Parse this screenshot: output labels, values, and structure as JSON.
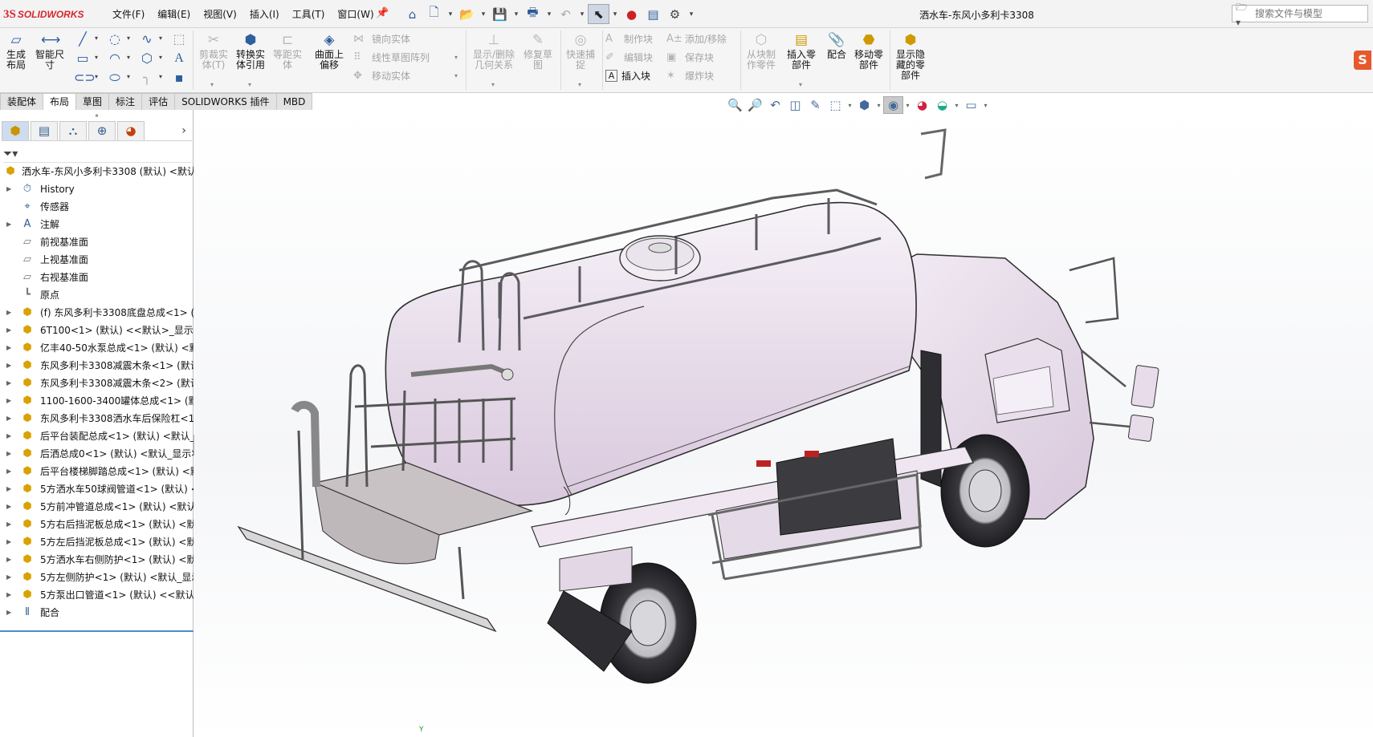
{
  "app": {
    "logo_ds": "3S",
    "logo_text": "SOLIDWORKS",
    "doc_title": "洒水车-东风小多利卡3308"
  },
  "menus": [
    "文件(F)",
    "编辑(E)",
    "视图(V)",
    "插入(I)",
    "工具(T)",
    "窗口(W)"
  ],
  "search": {
    "placeholder": "搜索文件与模型"
  },
  "ribbon": {
    "generate_layout": "生成\n布局",
    "smart_dimension": "智能尺\n寸",
    "trim_entities": "剪裁实\n体(T)",
    "convert_entities": "转换实\n体引用",
    "offset_entities": "等距实\n体",
    "offset_on_surface": "曲面上\n偏移",
    "mirror_entities": "镜向实体",
    "linear_pattern": "线性草图阵列",
    "move_entities": "移动实体",
    "display_relations": "显示/删除\n几何关系",
    "repair_sketch": "修复草\n图",
    "quick_snap": "快速捕\n捉",
    "make_block": "制作块",
    "edit_block": "编辑块",
    "insert_block": "插入块",
    "add_remove": "添加/移除",
    "save_block": "保存块",
    "explode_block": "爆炸块",
    "make_part_from_block": "从块制\n作零件",
    "insert_component": "插入零\n部件",
    "mate": "配合",
    "move_component": "移动零\n部件",
    "show_hidden": "显示隐\n藏的零\n部件"
  },
  "tabs": [
    "装配体",
    "布局",
    "草图",
    "标注",
    "评估",
    "SOLIDWORKS 插件",
    "MBD"
  ],
  "active_tab": "布局",
  "tree": {
    "root": "洒水车-东风小多利卡3308 (默认) <默认",
    "items": [
      {
        "label": "History",
        "icon": "history-icon"
      },
      {
        "label": "传感器",
        "icon": "sensor-icon"
      },
      {
        "label": "注解",
        "icon": "annotation-icon"
      },
      {
        "label": "前视基准面",
        "icon": "plane-icon"
      },
      {
        "label": "上视基准面",
        "icon": "plane-icon"
      },
      {
        "label": "右视基准面",
        "icon": "plane-icon"
      },
      {
        "label": "原点",
        "icon": "origin-icon"
      },
      {
        "label": "(f) 东风多利卡3308底盘总成<1> (默",
        "icon": "part-icon"
      },
      {
        "label": "6T100<1> (默认) <<默认>_显示状",
        "icon": "part-icon"
      },
      {
        "label": "亿丰40-50水泵总成<1> (默认) <默",
        "icon": "part-icon"
      },
      {
        "label": "东风多利卡3308减震木条<1> (默认",
        "icon": "part-icon"
      },
      {
        "label": "东风多利卡3308减震木条<2> (默认",
        "icon": "part-icon"
      },
      {
        "label": "1100-1600-3400罐体总成<1> (默认",
        "icon": "part-icon"
      },
      {
        "label": "东风多利卡3308洒水车后保险杠<1",
        "icon": "part-icon"
      },
      {
        "label": "后平台装配总成<1> (默认) <默认_显",
        "icon": "part-icon"
      },
      {
        "label": "后洒总成0<1> (默认) <默认_显示状",
        "icon": "part-icon"
      },
      {
        "label": "后平台楼梯脚踏总成<1> (默认) <默",
        "icon": "part-icon"
      },
      {
        "label": "5方洒水车50球阀管道<1> (默认) <",
        "icon": "part-icon"
      },
      {
        "label": "5方前冲管道总成<1> (默认) <默认_",
        "icon": "part-icon"
      },
      {
        "label": "5方右后挡泥板总成<1> (默认) <默",
        "icon": "part-icon"
      },
      {
        "label": "5方左后挡泥板总成<1> (默认) <默",
        "icon": "part-icon"
      },
      {
        "label": "5方洒水车右侧防护<1> (默认) <默认",
        "icon": "part-icon"
      },
      {
        "label": "5方左侧防护<1> (默认) <默认_显示",
        "icon": "part-icon"
      },
      {
        "label": "5方泵出口管道<1> (默认) <<默认:",
        "icon": "part-icon"
      },
      {
        "label": "配合",
        "icon": "mates-icon"
      }
    ]
  },
  "graphics": {
    "triad_label": "Y"
  },
  "colors": {
    "tank_body": "#ece3ee",
    "cab": "#e8dcea",
    "accent": "#d8262e"
  }
}
